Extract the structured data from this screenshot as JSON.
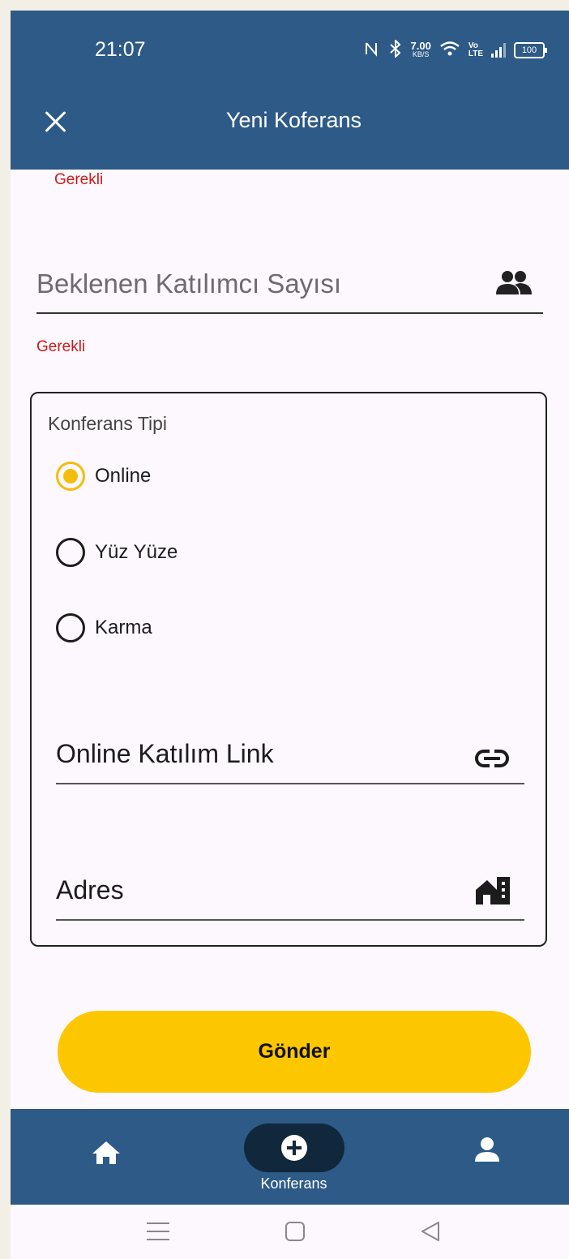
{
  "status": {
    "time": "21:07",
    "net_speed": "7.00",
    "net_unit": "KB/S",
    "volte_top": "Vo",
    "volte_bottom": "LTE",
    "battery": "100"
  },
  "appbar": {
    "title": "Yeni Koferans"
  },
  "form": {
    "error_top": "Gerekli",
    "participants_placeholder": "Beklenen Katılımcı Sayısı",
    "participants_error": "Gerekli",
    "type_label": "Konferans Tipi",
    "options": [
      {
        "label": "Online",
        "selected": true
      },
      {
        "label": "Yüz Yüze",
        "selected": false
      },
      {
        "label": "Karma",
        "selected": false
      }
    ],
    "link_label": "Online Katılım Link",
    "address_label": "Adres",
    "submit_label": "Gönder"
  },
  "bottom_nav": {
    "items": [
      {
        "icon": "home-icon"
      },
      {
        "icon": "add-circle-icon",
        "label": "Konferans"
      },
      {
        "icon": "person-icon"
      }
    ]
  },
  "colors": {
    "primary": "#2d5a86",
    "accent": "#fdc700",
    "error": "#cc1a1a",
    "nav_selected": "#11273b"
  }
}
